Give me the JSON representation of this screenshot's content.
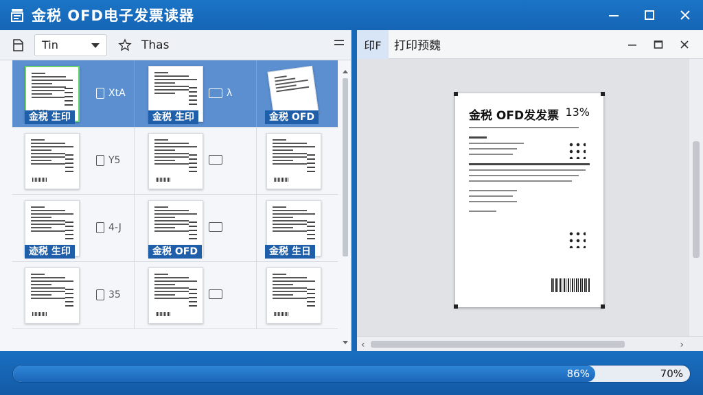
{
  "window": {
    "title": "金税 OFD电子发票读器",
    "controls": [
      "—",
      "☐",
      "✕"
    ]
  },
  "left_toolbar": {
    "combo_value": "Tin",
    "label": "Thas"
  },
  "grid": {
    "rows": [
      {
        "selected": true,
        "cells": [
          {
            "badge": "金税 生印",
            "side_text": "XtA",
            "highlight": true
          },
          {
            "badge": "金税 生印",
            "side_text": "λ"
          },
          {
            "badge": "金税 OFD"
          }
        ]
      },
      {
        "selected": false,
        "cells": [
          {
            "badge": "",
            "side_text": "Y5"
          },
          {
            "badge": "",
            "side_text": ""
          },
          {
            "badge": ""
          }
        ]
      },
      {
        "selected": false,
        "cells": [
          {
            "badge": "迹税 生印",
            "side_text": "4-J"
          },
          {
            "badge": "金税 OFD",
            "side_text": ""
          },
          {
            "badge": "金税 生日"
          }
        ]
      },
      {
        "selected": false,
        "cells": [
          {
            "badge": "",
            "side_text": "35"
          },
          {
            "badge": "",
            "side_text": ""
          },
          {
            "badge": ""
          }
        ]
      }
    ]
  },
  "preview": {
    "tab_label": "印F​",
    "title": "打印预魏",
    "page_title": "金税 OFD发发票",
    "page_percent": "13%"
  },
  "progress": {
    "value_percent": 86,
    "label": "86%",
    "right_label": "70%"
  }
}
